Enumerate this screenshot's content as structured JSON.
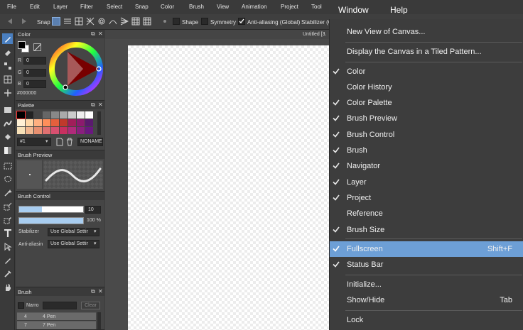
{
  "menubar": {
    "items": [
      "File",
      "Edit",
      "Layer",
      "Filter",
      "Select",
      "Snap",
      "Color",
      "Brush",
      "View",
      "Animation",
      "Project",
      "Tool",
      "Window",
      "Help"
    ]
  },
  "toolbar": {
    "snap_label": "Snap",
    "shape_label": "Shape",
    "symmetry_label": "Symmetry",
    "antialias_label": "Anti-aliasing (Global)",
    "stabilizer_label": "Stabilizer (G"
  },
  "document": {
    "tab_title": "Untitled [3."
  },
  "color_panel": {
    "title": "Color",
    "r_label": "R",
    "r_value": "0",
    "g_label": "G",
    "g_value": "0",
    "b_label": "B",
    "b_value": "0",
    "hex": "#000000",
    "foreground": "#000000",
    "background": "#ffffff"
  },
  "palette_panel": {
    "title": "Palette",
    "selected": "#1",
    "name": "NONAME",
    "swatches": [
      "#000000",
      "#222222",
      "#444444",
      "#666666",
      "#888888",
      "#aaaaaa",
      "#cccccc",
      "#eeeeee",
      "#ffffff",
      "#fff1d6",
      "#ffd8a8",
      "#ffb080",
      "#ff8f5a",
      "#e4603c",
      "#c0392b",
      "#a01e5a",
      "#8c1a6e",
      "#5a1a6e",
      "#f7e1b8",
      "#f0b790",
      "#e89070",
      "#e07070",
      "#d85070",
      "#c83060",
      "#b02a7a",
      "#8a1f7e",
      "#6a1880"
    ]
  },
  "brush_preview_panel": {
    "title": "Brush Preview"
  },
  "brush_control_panel": {
    "title": "Brush Control",
    "size_value": "10",
    "opacity_value": "100 %",
    "size_fill": 0.35,
    "opacity_fill": 1.0,
    "stabilizer_label": "Stabilizer",
    "stabilizer_value": "Use Global Settir",
    "antialias_label": "Anti-aliasin",
    "antialias_value": "Use Global Settir"
  },
  "brush_panel": {
    "title": "Brush",
    "filter_label": "Narro",
    "clear_label": "Clear",
    "items": [
      {
        "size": "4",
        "name": "4 Pen"
      },
      {
        "size": "7",
        "name": "7 Pen"
      }
    ]
  },
  "window_menu": {
    "items": [
      {
        "label": "New View of Canvas...",
        "checked": false,
        "shortcut": ""
      },
      {
        "label": "Display the Canvas in a Tiled Pattern...",
        "checked": false,
        "shortcut": ""
      },
      {
        "label": "Color",
        "checked": true,
        "shortcut": ""
      },
      {
        "label": "Color History",
        "checked": false,
        "shortcut": ""
      },
      {
        "label": "Color Palette",
        "checked": true,
        "shortcut": ""
      },
      {
        "label": "Brush Preview",
        "checked": true,
        "shortcut": ""
      },
      {
        "label": "Brush Control",
        "checked": true,
        "shortcut": ""
      },
      {
        "label": "Brush",
        "checked": true,
        "shortcut": ""
      },
      {
        "label": "Navigator",
        "checked": true,
        "shortcut": ""
      },
      {
        "label": "Layer",
        "checked": true,
        "shortcut": ""
      },
      {
        "label": "Project",
        "checked": true,
        "shortcut": ""
      },
      {
        "label": "Reference",
        "checked": false,
        "shortcut": ""
      },
      {
        "label": "Brush Size",
        "checked": true,
        "shortcut": ""
      },
      {
        "label": "Fullscreen",
        "checked": true,
        "shortcut": "Shift+F"
      },
      {
        "label": "Status Bar",
        "checked": true,
        "shortcut": ""
      },
      {
        "label": "Initialize...",
        "checked": false,
        "shortcut": ""
      },
      {
        "label": "Show/Hide",
        "checked": false,
        "shortcut": "Tab"
      },
      {
        "label": "Lock",
        "checked": false,
        "shortcut": ""
      }
    ]
  },
  "colors": {
    "highlight": "#6d9fd6",
    "selected_tool": "#4a7fc0"
  }
}
